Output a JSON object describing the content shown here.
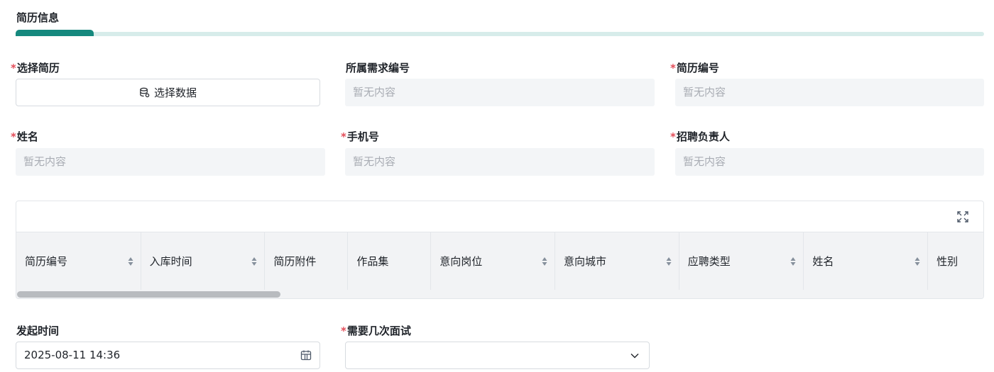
{
  "section": {
    "title": "简历信息"
  },
  "fields": {
    "select_resume": {
      "label": "选择简历",
      "button_label": "选择数据"
    },
    "demand_number": {
      "label": "所属需求编号",
      "placeholder": "暂无内容"
    },
    "resume_number": {
      "label": "简历编号",
      "placeholder": "暂无内容"
    },
    "name": {
      "label": "姓名",
      "placeholder": "暂无内容"
    },
    "phone": {
      "label": "手机号",
      "placeholder": "暂无内容"
    },
    "recruiter": {
      "label": "招聘负责人",
      "placeholder": "暂无内容"
    },
    "start_time": {
      "label": "发起时间",
      "value": "2025-08-11 14:36"
    },
    "interview_rounds": {
      "label": "需要几次面试",
      "value": ""
    }
  },
  "required_mark": "*",
  "table": {
    "columns": [
      {
        "label": "简历编号",
        "sortable": true
      },
      {
        "label": "入库时间",
        "sortable": true
      },
      {
        "label": "简历附件",
        "sortable": false
      },
      {
        "label": "作品集",
        "sortable": false
      },
      {
        "label": "意向岗位",
        "sortable": true
      },
      {
        "label": "意向城市",
        "sortable": true
      },
      {
        "label": "应聘类型",
        "sortable": true
      },
      {
        "label": "姓名",
        "sortable": true
      },
      {
        "label": "性别",
        "sortable": false
      }
    ]
  },
  "colors": {
    "accent": "#16897e",
    "required": "#e34d59",
    "placeholder": "#a8acb3"
  },
  "icons": [
    "database-icon",
    "fullscreen-icon",
    "sort-icon",
    "calendar-icon",
    "chevron-down-icon"
  ]
}
